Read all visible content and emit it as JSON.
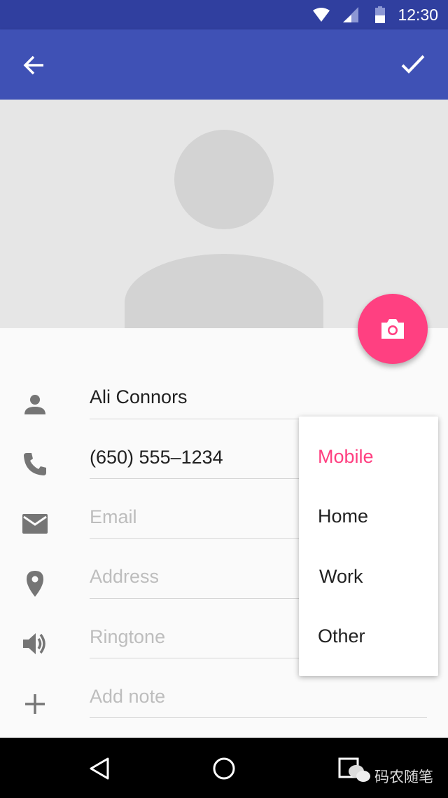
{
  "status_bar": {
    "time": "12:30",
    "icons": [
      "wifi-icon",
      "signal-icon",
      "battery-icon"
    ]
  },
  "toolbar": {
    "back_icon": "arrow-back-icon",
    "save_icon": "check-icon"
  },
  "fab": {
    "icon": "camera-icon",
    "color": "#FF4081"
  },
  "form": {
    "name": {
      "value": "Ali Connors",
      "icon": "person-icon"
    },
    "phone": {
      "value": "(650) 555–1234",
      "icon": "phone-icon"
    },
    "email": {
      "placeholder": "Email",
      "icon": "email-icon"
    },
    "address": {
      "placeholder": "Address",
      "icon": "location-icon"
    },
    "ringtone": {
      "placeholder": "Ringtone",
      "icon": "volume-icon"
    },
    "note": {
      "placeholder": "Add note",
      "icon": "plus-icon"
    }
  },
  "phone_type_menu": {
    "items": [
      "Mobile",
      "Home",
      "Work",
      "Other"
    ],
    "selected": "Mobile",
    "accent": "#FF4081"
  },
  "watermark": "码农随笔",
  "colors": {
    "primary": "#3F51B5",
    "primary_dark": "#303F9F"
  }
}
